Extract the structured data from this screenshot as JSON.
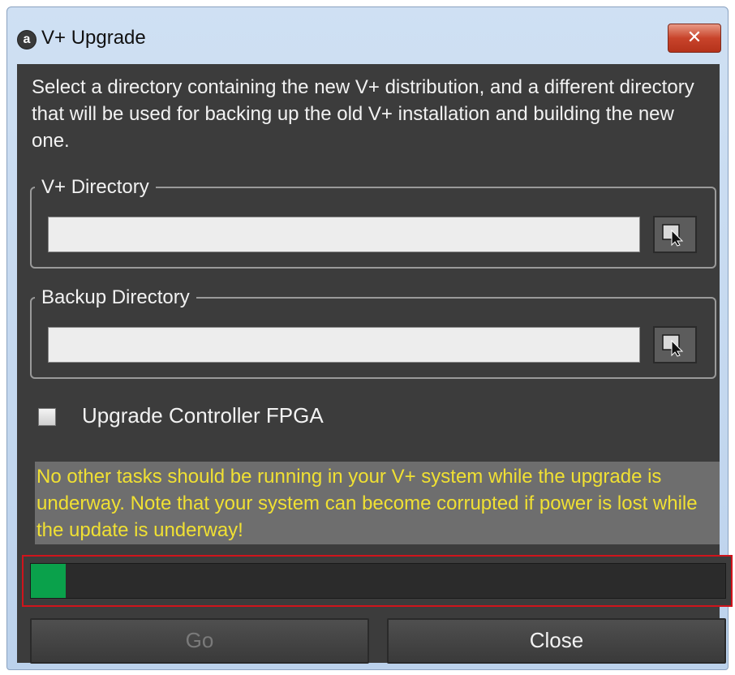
{
  "window": {
    "title": "V+ Upgrade",
    "icon_letter": "a",
    "close_glyph": "✕"
  },
  "intro_text": "Select a directory containing the new V+ distribution, and a different directory that will be used for backing up the old V+ installation and building the new one.",
  "vplus_directory": {
    "legend": "V+ Directory",
    "value": "",
    "browse_icon": "cursor-select-icon"
  },
  "backup_directory": {
    "legend": "Backup Directory",
    "value": "",
    "browse_icon": "cursor-select-icon"
  },
  "fpga": {
    "label": "Upgrade Controller FPGA",
    "checked": false
  },
  "warning_text": "No other tasks should be running in your V+ system while the upgrade is underway. Note that your system can become corrupted if power is lost while the update is underway!",
  "progress": {
    "percent": 5,
    "color": "#0aa14b",
    "highlight_color": "#d0141c"
  },
  "buttons": {
    "go_label": "Go",
    "close_label": "Close"
  }
}
